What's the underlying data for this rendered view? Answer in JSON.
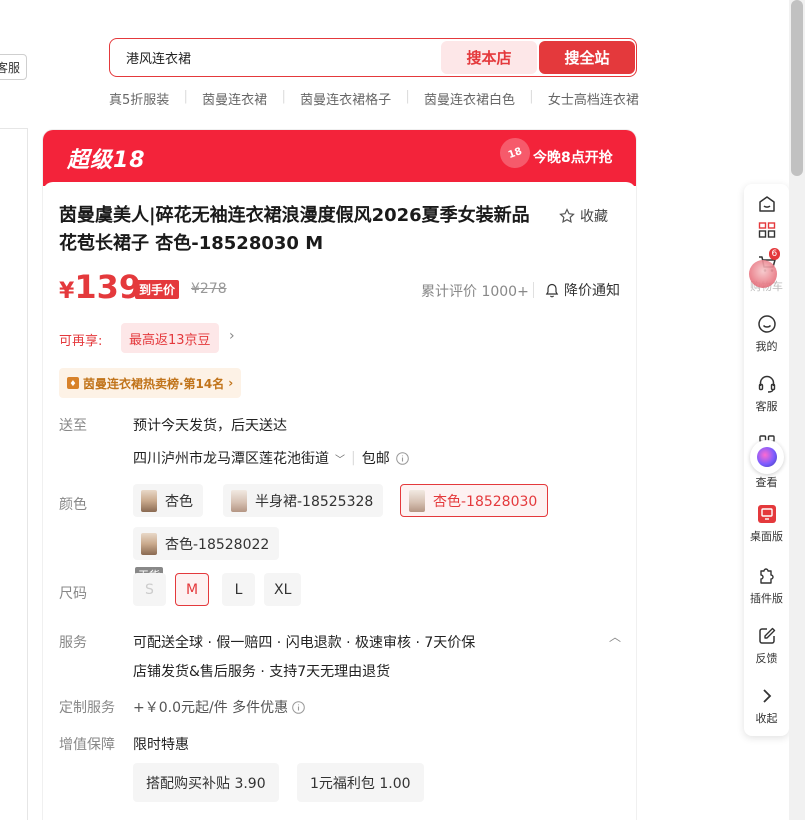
{
  "left_edge": {
    "service_label": "客服"
  },
  "search": {
    "query": "港风连衣裙",
    "store_button": "搜本店",
    "all_button": "搜全站"
  },
  "hot_words": [
    "真5折服装",
    "茵曼连衣裙",
    "茵曼连衣裙格子",
    "茵曼连衣裙白色",
    "女士高档连衣裙"
  ],
  "banner": {
    "title": "超级18",
    "badge": "18",
    "notice": "今晚8点开抢"
  },
  "product": {
    "title": "茵曼虞美人|碎花无袖连衣裙浪漫度假风2026夏季女装新品花苞长裙子 杏色-18528030 M",
    "favorite_label": "收藏",
    "price_symbol": "¥",
    "price": "139",
    "price_tag": "到手价",
    "original_price": "¥278",
    "review": "累计评价 1000+",
    "price_notify": "降价通知",
    "reenjoy_label": "可再享:",
    "reenjoy_tag": "最高返13京豆",
    "rank_label": "茵曼连衣裙热卖榜·第14名"
  },
  "delivery": {
    "label": "送至",
    "estimate": "预计今天发货，后天送达",
    "address": "四川泸州市龙马潭区莲花池街道",
    "shipping": "包邮"
  },
  "colors": {
    "label": "颜色",
    "options": [
      "杏色",
      "半身裙-18525328",
      "杏色-18528030",
      "杏色-18528022"
    ],
    "selected": "杏色-18528030"
  },
  "sizes": {
    "label": "尺码",
    "options": [
      "S",
      "M",
      "L",
      "XL"
    ],
    "selected": "M",
    "out_of_stock_tag": "无货"
  },
  "service": {
    "label": "服务",
    "line1": "可配送全球 · 假一赔四 · 闪电退款 · 极速审核 · 7天价保",
    "line2": "店铺发货&售后服务 · 支持7天无理由退货"
  },
  "custom_service": {
    "label": "定制服务",
    "value": "+￥0.0元起/件 多件优惠"
  },
  "value_added": {
    "label": "增值保障",
    "value": "限时特惠",
    "options": [
      "搭配购买补贴 3.90",
      "1元福利包 1.00"
    ]
  },
  "sidebar": {
    "items": [
      {
        "label": "",
        "icon": "home-icon"
      },
      {
        "label": "",
        "icon": "grid-icon"
      },
      {
        "label": "购物车",
        "icon": "cart-icon",
        "badge": "6"
      },
      {
        "label": "我的",
        "icon": "smile-icon"
      },
      {
        "label": "客服",
        "icon": "headset-icon"
      },
      {
        "label": "查看",
        "icon": "apps-icon"
      },
      {
        "label": "桌面版",
        "icon": "desktop-icon"
      },
      {
        "label": "插件版",
        "icon": "plugin-icon"
      },
      {
        "label": "反馈",
        "icon": "edit-icon"
      },
      {
        "label": "收起",
        "icon": "chevron-right-icon"
      }
    ]
  },
  "colors_theme": {
    "accent": "#e4393c",
    "banner": "#f3233a",
    "rank_text": "#c1741b"
  }
}
